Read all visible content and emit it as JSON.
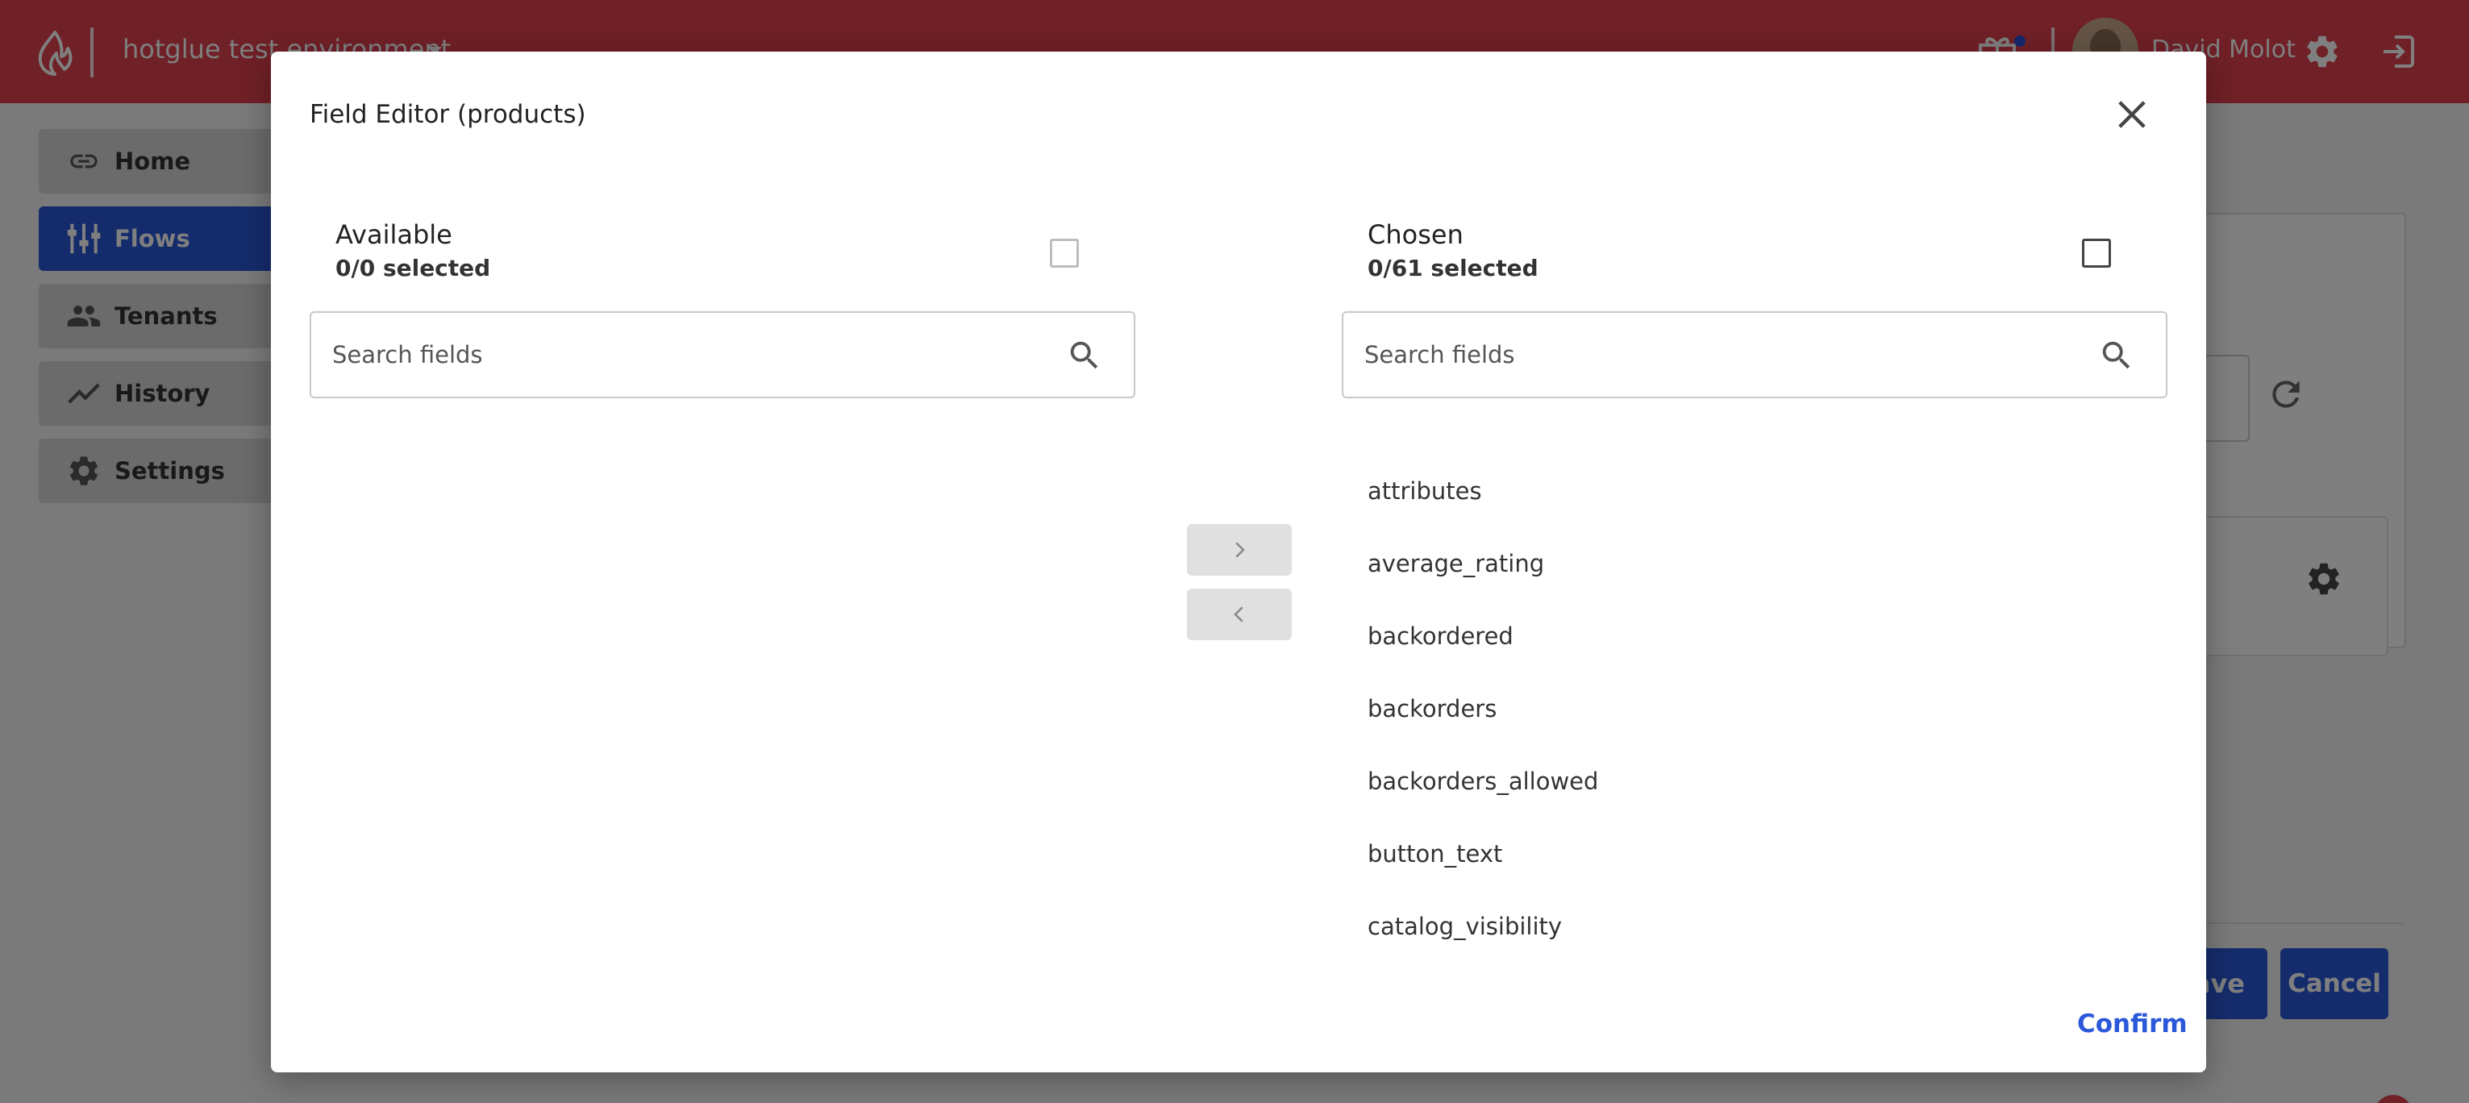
{
  "header": {
    "environment_name": "hotglue test environment",
    "user_name": "David Molot",
    "colors": {
      "brand": "#e0404e",
      "accent": "#2b58d9"
    }
  },
  "sidebar": {
    "items": [
      {
        "label": "Home",
        "icon": "link-icon",
        "active": false
      },
      {
        "label": "Flows",
        "icon": "flows-icon",
        "active": true
      },
      {
        "label": "Tenants",
        "icon": "users-icon",
        "active": false
      },
      {
        "label": "History",
        "icon": "chart-line-icon",
        "active": false
      },
      {
        "label": "Settings",
        "icon": "gear-icon",
        "active": false
      }
    ]
  },
  "page": {
    "save_label": "Save",
    "cancel_label": "Cancel"
  },
  "modal": {
    "title": "Field Editor (products)",
    "confirm_label": "Confirm",
    "available": {
      "title": "Available",
      "count": "0/0 selected",
      "search_placeholder": "Search fields"
    },
    "chosen": {
      "title": "Chosen",
      "count": "0/61 selected",
      "search_placeholder": "Search fields",
      "fields": [
        "attributes",
        "average_rating",
        "backordered",
        "backorders",
        "backorders_allowed",
        "button_text",
        "catalog_visibility"
      ]
    }
  }
}
